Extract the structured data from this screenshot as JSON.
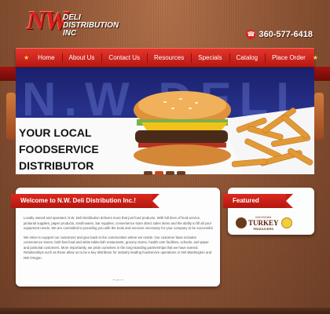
{
  "logo": {
    "mark": "NW",
    "line1": "DELI",
    "line2": "DISTRIBUTION",
    "line3": "INC"
  },
  "phone": {
    "number": "360-577-6418",
    "icon": "phone-icon"
  },
  "nav": {
    "items": [
      "Home",
      "About Us",
      "Contact Us",
      "Resources",
      "Specials",
      "Catalog",
      "Place Order"
    ]
  },
  "slider": {
    "background_text": "N.W DELI",
    "caption": [
      "YOUR LOCAL",
      "FOODSERVICE",
      "DISTRIBUTOR"
    ],
    "active_slide": 1,
    "slide_count": 4
  },
  "welcome": {
    "title": "Welcome to N.W. Deli Distribution Inc.!",
    "p1": "Locally owned and operated, N.W. Deli Distribution delivers more that just food products. With full lines of food service, janitorial supplies, paper products, small wares, bar supplies, convenience store direct sales items and the ability to fill all your equipment needs. We are committed to providing you with the tools and services necessary for your company to be successful.",
    "p2": "We strive to support our customers and give back to the communities where we reside. Our customer base includes convenience stores, both fast food and white tablecloth restaurants, grocery stores, health care facilities, schools, and paper and janitorial customers. More importantly, we pride ourselves in the long-standing partnerships that we have earned. Relationships such as these allow us to be a key distributor for industry leading foodservice operations in SW Washington and NW Oregon."
  },
  "vendors": {
    "title": "Featured Vendors",
    "logo_top": "MICHIGAN",
    "logo_main": "TURKEY",
    "logo_bottom": "PRODUCERS"
  },
  "colors": {
    "accent": "#d8231e",
    "nav_bg": "#c41f16",
    "star": "#ffd23a",
    "background": "#8a5233"
  }
}
